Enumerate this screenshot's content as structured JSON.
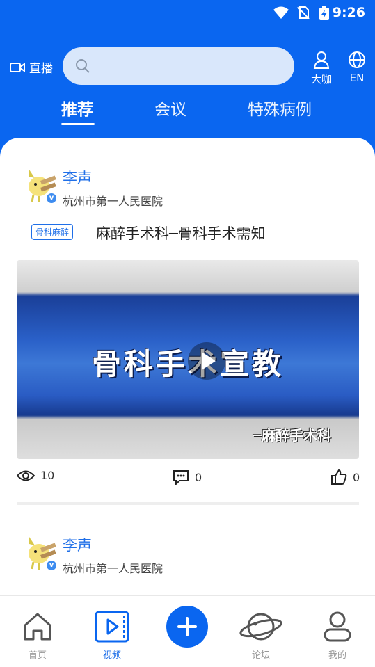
{
  "status_bar": {
    "time": "9:26"
  },
  "header": {
    "live_label": "直播",
    "search_placeholder": "",
    "expert_label": "大咖",
    "lang_label": "EN"
  },
  "tabs": [
    {
      "label": "推荐",
      "active": true
    },
    {
      "label": "会议",
      "active": false
    },
    {
      "label": "特殊病例",
      "active": false
    }
  ],
  "posts": [
    {
      "author": "李声",
      "hospital": "杭州市第一人民医院",
      "tag": "骨科麻醉",
      "title": "麻醉手术科─骨科手术需知",
      "video_title_text": "骨科手术宣教",
      "video_sub_text": "─麻醉手术科",
      "views": "10",
      "comments": "0",
      "likes": "0"
    },
    {
      "author": "李声",
      "hospital": "杭州市第一人民医院"
    }
  ],
  "bottom_nav": [
    {
      "label": "首页",
      "icon": "home-icon",
      "active": false
    },
    {
      "label": "视频",
      "icon": "video-icon",
      "active": true
    },
    {
      "label": "",
      "icon": "plus-icon",
      "active": false
    },
    {
      "label": "论坛",
      "icon": "planet-icon",
      "active": false
    },
    {
      "label": "我的",
      "icon": "user-icon",
      "active": false
    }
  ],
  "colors": {
    "brand": "#0a66f0",
    "accent_text": "#1f6fe8"
  }
}
